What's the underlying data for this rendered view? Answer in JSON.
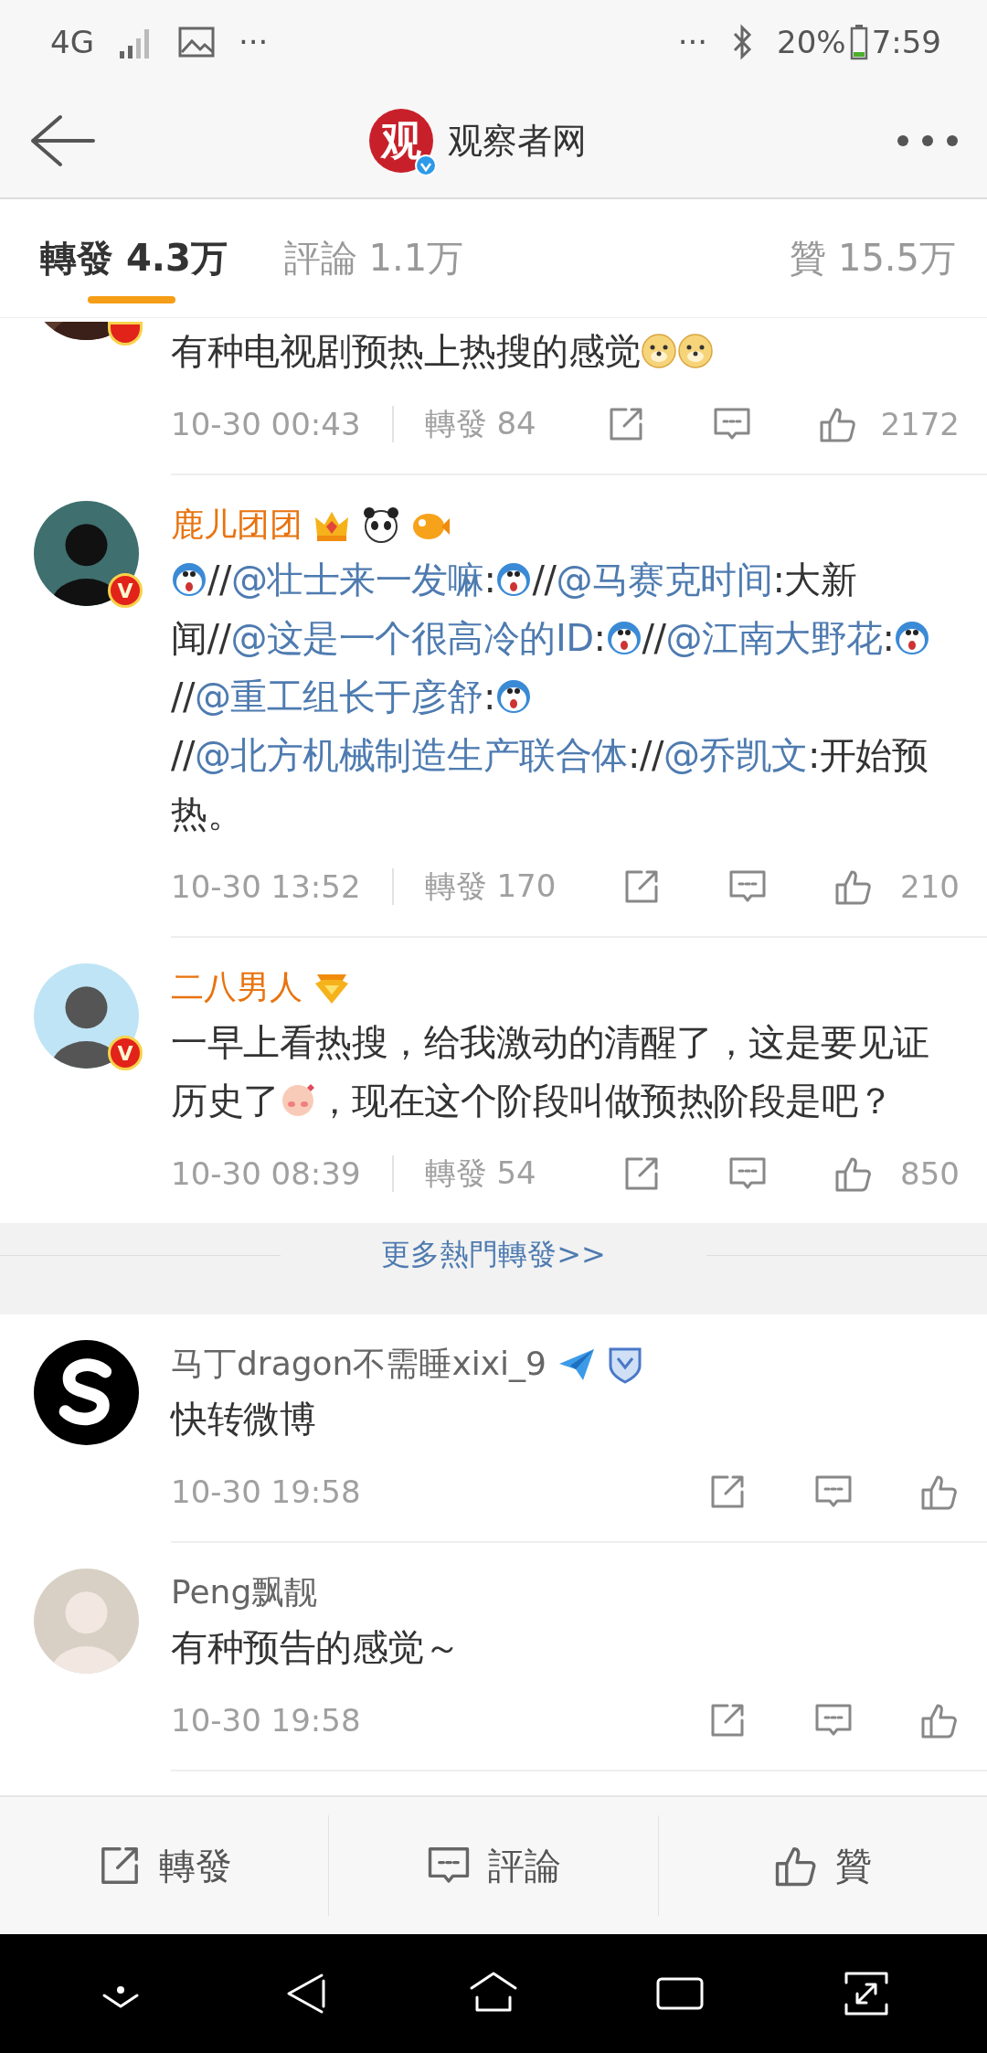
{
  "status_bar": {
    "network": "4G",
    "more_left": "···",
    "more_right": "···",
    "battery": "20%",
    "time": "7:59"
  },
  "header": {
    "logo_text": "观",
    "title": "观察者网",
    "verified": true
  },
  "tabs": [
    {
      "label": "轉發",
      "count": "4.3万",
      "selected": true
    },
    {
      "label": "評論",
      "count": "1.1万",
      "selected": false
    },
    {
      "label": "贊",
      "count": "15.5万",
      "selected": false
    }
  ],
  "hot_reposts": [
    {
      "partial": true,
      "avatar": {
        "kind": "picture"
      },
      "verified": true,
      "body": [
        {
          "kind": "text",
          "text": "有种电视剧预热上热搜的感觉"
        },
        {
          "kind": "doge"
        },
        {
          "kind": "doge"
        }
      ],
      "time": "10-30 00:43",
      "repost_label": "轉發",
      "repost_count": "84",
      "likes": "2172"
    },
    {
      "partial": false,
      "name": "鹿儿团团",
      "vip": true,
      "badges": [
        {
          "kind": "crown"
        },
        {
          "kind": "panda"
        },
        {
          "kind": "fish"
        }
      ],
      "avatar": {
        "kind": "picture"
      },
      "verified_mark": "V",
      "body": [
        {
          "kind": "robot"
        },
        {
          "kind": "text",
          "text": "//"
        },
        {
          "kind": "mention",
          "text": "@壮士来一发嘛"
        },
        {
          "kind": "text",
          "text": ":"
        },
        {
          "kind": "robot"
        },
        {
          "kind": "text",
          "text": "//"
        },
        {
          "kind": "mention",
          "text": "@马赛克时间"
        },
        {
          "kind": "text",
          "text": ":大新闻//"
        },
        {
          "kind": "mention",
          "text": "@这是一个很高冷的ID"
        },
        {
          "kind": "text",
          "text": ":"
        },
        {
          "kind": "robot"
        },
        {
          "kind": "text",
          "text": "//"
        },
        {
          "kind": "mention",
          "text": "@江南大野花"
        },
        {
          "kind": "text",
          "text": ":"
        },
        {
          "kind": "robot"
        },
        {
          "kind": "text",
          "text": "//"
        },
        {
          "kind": "mention",
          "text": "@重工组长于彦舒"
        },
        {
          "kind": "text",
          "text": ":"
        },
        {
          "kind": "robot"
        },
        {
          "kind": "text",
          "text": "//"
        },
        {
          "kind": "mention",
          "text": "@北方机械制造生产联合体"
        },
        {
          "kind": "text",
          "text": "://"
        },
        {
          "kind": "mention",
          "text": "@乔凯文"
        },
        {
          "kind": "text",
          "text": ":开始预热。"
        }
      ],
      "time": "10-30 13:52",
      "repost_label": "轉發",
      "repost_count": "170",
      "likes": "210"
    },
    {
      "partial": false,
      "name": "二八男人",
      "vip": true,
      "badges": [
        {
          "kind": "medal"
        }
      ],
      "avatar": {
        "kind": "picture"
      },
      "verified_mark": "V",
      "body": [
        {
          "kind": "text",
          "text": "一早上看热搜，给我激动的清醒了，这是要见证历史了"
        },
        {
          "kind": "shy"
        },
        {
          "kind": "text",
          "text": "，现在这个阶段叫做预热阶段是吧？"
        }
      ],
      "time": "10-30 08:39",
      "repost_label": "轉發",
      "repost_count": "54",
      "likes": "850"
    }
  ],
  "more_link": "更多熱門轉發>>",
  "reposts": [
    {
      "partial": false,
      "name": "马丁dragon不需睡xixi_9",
      "vip": false,
      "badges": [
        {
          "kind": "plane"
        },
        {
          "kind": "shield"
        }
      ],
      "avatar": {
        "kind": "logo"
      },
      "body": [
        {
          "kind": "text",
          "text": "快转微博"
        }
      ],
      "time": "10-30 19:58"
    },
    {
      "partial": false,
      "name": "Peng飘靓",
      "vip": false,
      "avatar": {
        "kind": "picture"
      },
      "body": [
        {
          "kind": "text",
          "text": "有种预告的感觉～"
        }
      ],
      "time": "10-30 19:58"
    }
  ],
  "bottom_bar": [
    {
      "kind": "repost",
      "label": "轉發"
    },
    {
      "kind": "comment",
      "label": "評論"
    },
    {
      "kind": "like",
      "label": "贊"
    }
  ]
}
